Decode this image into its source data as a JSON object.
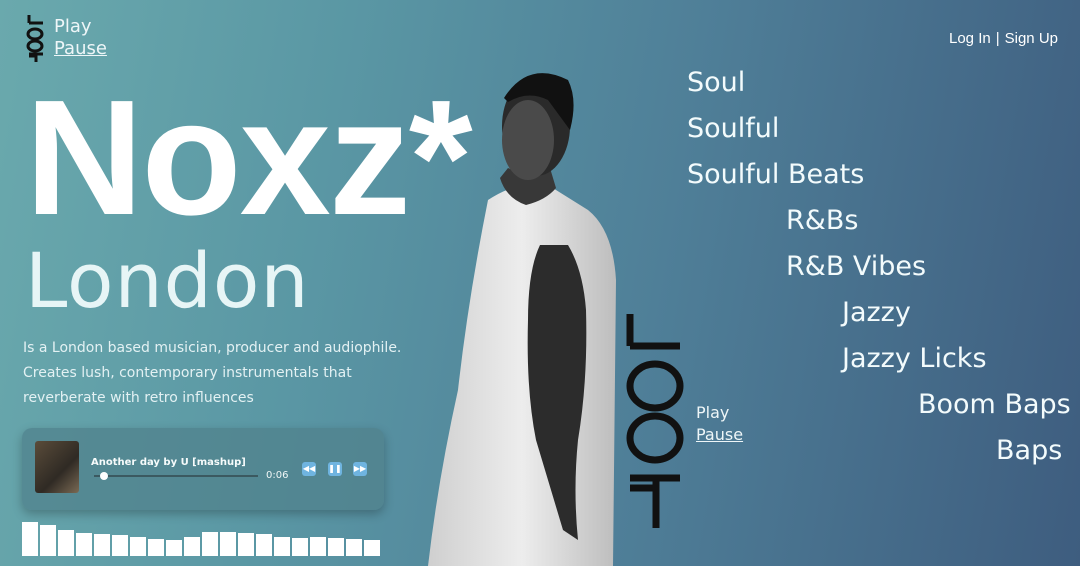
{
  "brand": {
    "logo_text": "LOOP"
  },
  "header": {
    "play_label": "Play",
    "pause_label": "Pause",
    "login_label": "Log In",
    "separator": "|",
    "signup_label": "Sign Up"
  },
  "hero": {
    "artist": "Noxz*",
    "city": "London",
    "bio": "Is a London based musician, producer and audiophile. Creates lush, contemporary instrumentals that reverberate with retro influences"
  },
  "player": {
    "track_title": "Another day by U [mashup]",
    "time": "0:06",
    "progress": 0.04,
    "icons": [
      "rewind-icon",
      "pause-icon",
      "fast-forward-icon"
    ]
  },
  "equalizer": {
    "levels": [
      1.0,
      0.92,
      0.75,
      0.68,
      0.65,
      0.62,
      0.55,
      0.5,
      0.48,
      0.55,
      0.7,
      0.72,
      0.68,
      0.65,
      0.55,
      0.52,
      0.55,
      0.52,
      0.5,
      0.48
    ]
  },
  "side_player": {
    "play_label": "Play",
    "pause_label": "Pause"
  },
  "genres": [
    "Soul",
    "Soulful",
    "Soulful Beats",
    "R&Bs",
    "R&B Vibes",
    "Jazzy",
    "Jazzy Licks",
    "Boom Baps",
    "Baps"
  ],
  "colors": {
    "accent": "#6fb4e0",
    "text": "#eef6f8"
  }
}
